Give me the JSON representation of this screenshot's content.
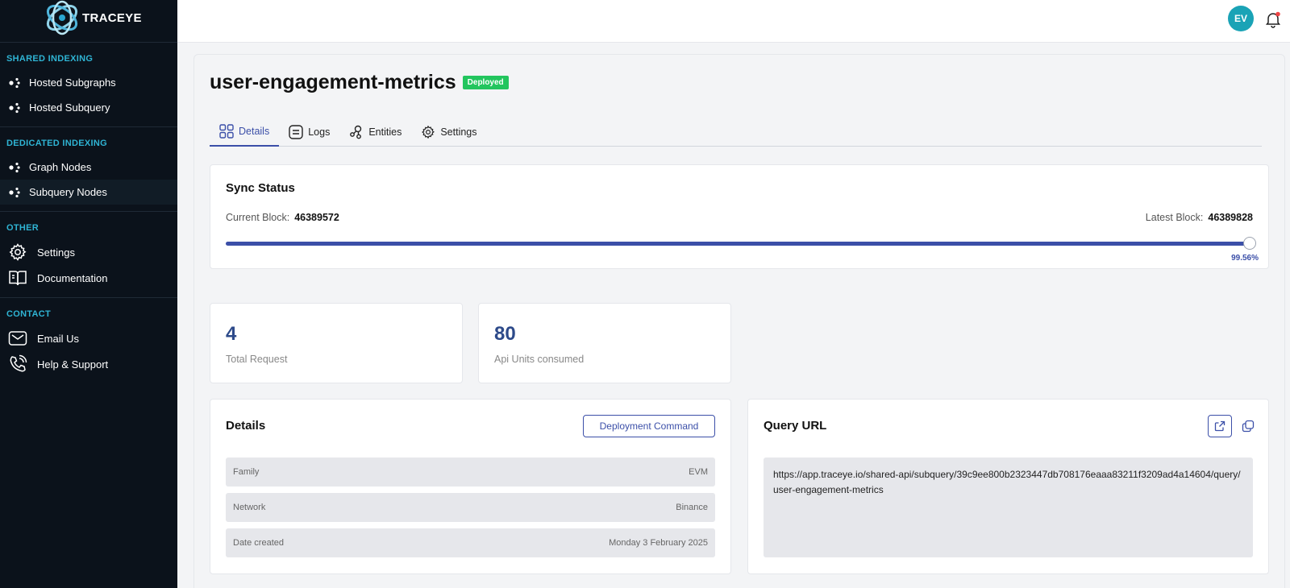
{
  "app": {
    "logo_text": "TRACEYE"
  },
  "sidebar": {
    "sections": [
      {
        "title": "SHARED INDEXING",
        "items": [
          "Hosted Subgraphs",
          "Hosted Subquery"
        ]
      },
      {
        "title": "DEDICATED INDEXING",
        "items": [
          "Graph Nodes",
          "Subquery Nodes"
        ]
      },
      {
        "title": "OTHER",
        "items": [
          "Settings",
          "Documentation"
        ]
      },
      {
        "title": "CONTACT",
        "items": [
          "Email Us",
          "Help & Support"
        ]
      }
    ],
    "active_item": "Subquery Nodes"
  },
  "header": {
    "avatar_initials": "EV"
  },
  "page": {
    "title": "user-engagement-metrics",
    "status_badge": "Deployed",
    "tabs": [
      "Details",
      "Logs",
      "Entities",
      "Settings"
    ],
    "active_tab": "Details"
  },
  "sync": {
    "title": "Sync Status",
    "current_label": "Current Block:",
    "current_value": "46389572",
    "latest_label": "Latest Block:",
    "latest_value": "46389828",
    "percent_text": "99.56%",
    "progress": 0.9956
  },
  "stats": [
    {
      "value": "4",
      "label": "Total Request"
    },
    {
      "value": "80",
      "label": "Api Units consumed"
    }
  ],
  "details": {
    "title": "Details",
    "button": "Deployment Command",
    "rows": [
      {
        "key": "Family",
        "value": "EVM"
      },
      {
        "key": "Network",
        "value": "Binance"
      },
      {
        "key": "Date created",
        "value": "Monday 3 February 2025"
      }
    ]
  },
  "query": {
    "title": "Query URL",
    "url": "https://app.traceye.io/shared-api/subquery/39c9ee800b2323447db708176eaaa83211f3209ad4a14604/query/user-engagement-metrics"
  },
  "colors": {
    "accent": "#3b4fa8",
    "sidebar_bg": "#0b121b",
    "section_title": "#2fb4d4",
    "badge": "#22c55e",
    "avatar": "#1aa3b6"
  }
}
